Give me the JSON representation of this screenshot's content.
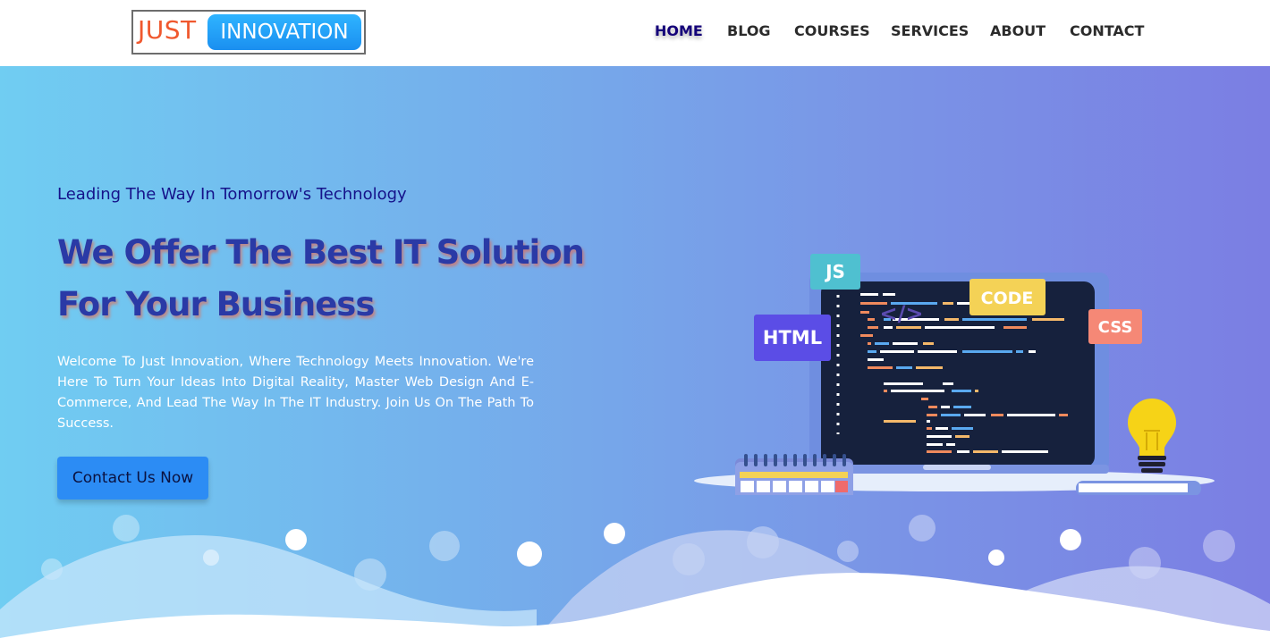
{
  "brand": {
    "just": "JUST",
    "innovation": "INNOVATION"
  },
  "nav": [
    {
      "label": "HOME",
      "active": true
    },
    {
      "label": "BLOG",
      "active": false
    },
    {
      "label": "COURSES",
      "active": false
    },
    {
      "label": "SERVICES",
      "active": false
    },
    {
      "label": "ABOUT",
      "active": false
    },
    {
      "label": "CONTACT",
      "active": false
    }
  ],
  "hero": {
    "eyebrow": "Leading The Way In Tomorrow's Technology",
    "headline_line1": "We Offer The Best IT Solution",
    "headline_line2": "For Your Business",
    "description": "Welcome To Just Innovation, Where Technology Meets Innovation. We're Here To Turn Your Ideas Into Digital Reality, Master Web Design And E-Commerce, And Lead The Way In The IT Industry. Join Us On The Path To Success.",
    "cta_label": "Contact Us Now"
  },
  "illustration": {
    "tags": {
      "js": "JS",
      "html": "HTML",
      "code_symbol": "</>",
      "code": "CODE",
      "css": "CSS"
    }
  },
  "colors": {
    "accent_blue": "#2c8cf4",
    "brand_orange": "#f0582e",
    "navy": "#15128a",
    "hero_start": "#70cdf2",
    "hero_end": "#7b7ee3"
  }
}
